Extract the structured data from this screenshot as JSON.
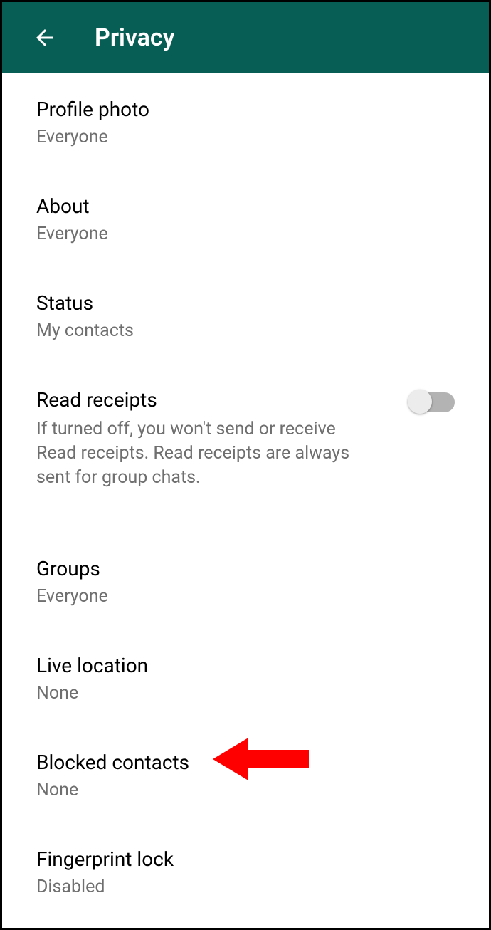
{
  "header": {
    "title": "Privacy"
  },
  "items": {
    "profilePhoto": {
      "title": "Profile photo",
      "value": "Everyone"
    },
    "about": {
      "title": "About",
      "value": "Everyone"
    },
    "status": {
      "title": "Status",
      "value": "My contacts"
    },
    "readReceipts": {
      "title": "Read receipts",
      "desc": "If turned off, you won't send or receive Read receipts. Read receipts are always sent for group chats.",
      "enabled": false
    },
    "groups": {
      "title": "Groups",
      "value": "Everyone"
    },
    "liveLocation": {
      "title": "Live location",
      "value": "None"
    },
    "blockedContacts": {
      "title": "Blocked contacts",
      "value": "None"
    },
    "fingerprintLock": {
      "title": "Fingerprint lock",
      "value": "Disabled"
    }
  },
  "annotation": {
    "arrowColor": "#ff0000"
  }
}
